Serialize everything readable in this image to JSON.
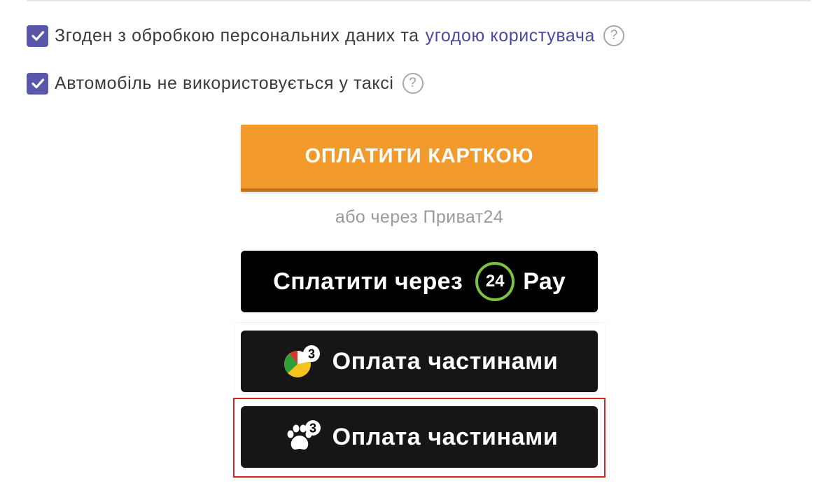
{
  "agreements": [
    {
      "label": "Згоден з обробкою персональних даних та",
      "link_text": "угодою користувача",
      "checked": true,
      "help_icon": "question-circle-icon"
    },
    {
      "label": "Автомобіль не використовується у таксі",
      "checked": true,
      "help_icon": "question-circle-icon"
    }
  ],
  "help_glyph": "?",
  "payment": {
    "card_button_label": "ОПЛАТИТИ КАРТКОЮ",
    "alternative_text": "або через Приват24",
    "privat_button": {
      "label": "Сплатити через",
      "badge": "24",
      "suffix": "Pay"
    },
    "installments": [
      {
        "label": "Оплата частинами",
        "icon": "pie-chart-3-icon",
        "badge": "3"
      },
      {
        "label": "Оплата частинами",
        "icon": "paw-3-icon",
        "badge": "3"
      }
    ]
  },
  "colors": {
    "checkbox": "#5a57a8",
    "link": "#4b4aa3",
    "card_button": "#f39a2c",
    "privat_ring": "#7cc242",
    "highlight_frame": "#d6232a"
  }
}
